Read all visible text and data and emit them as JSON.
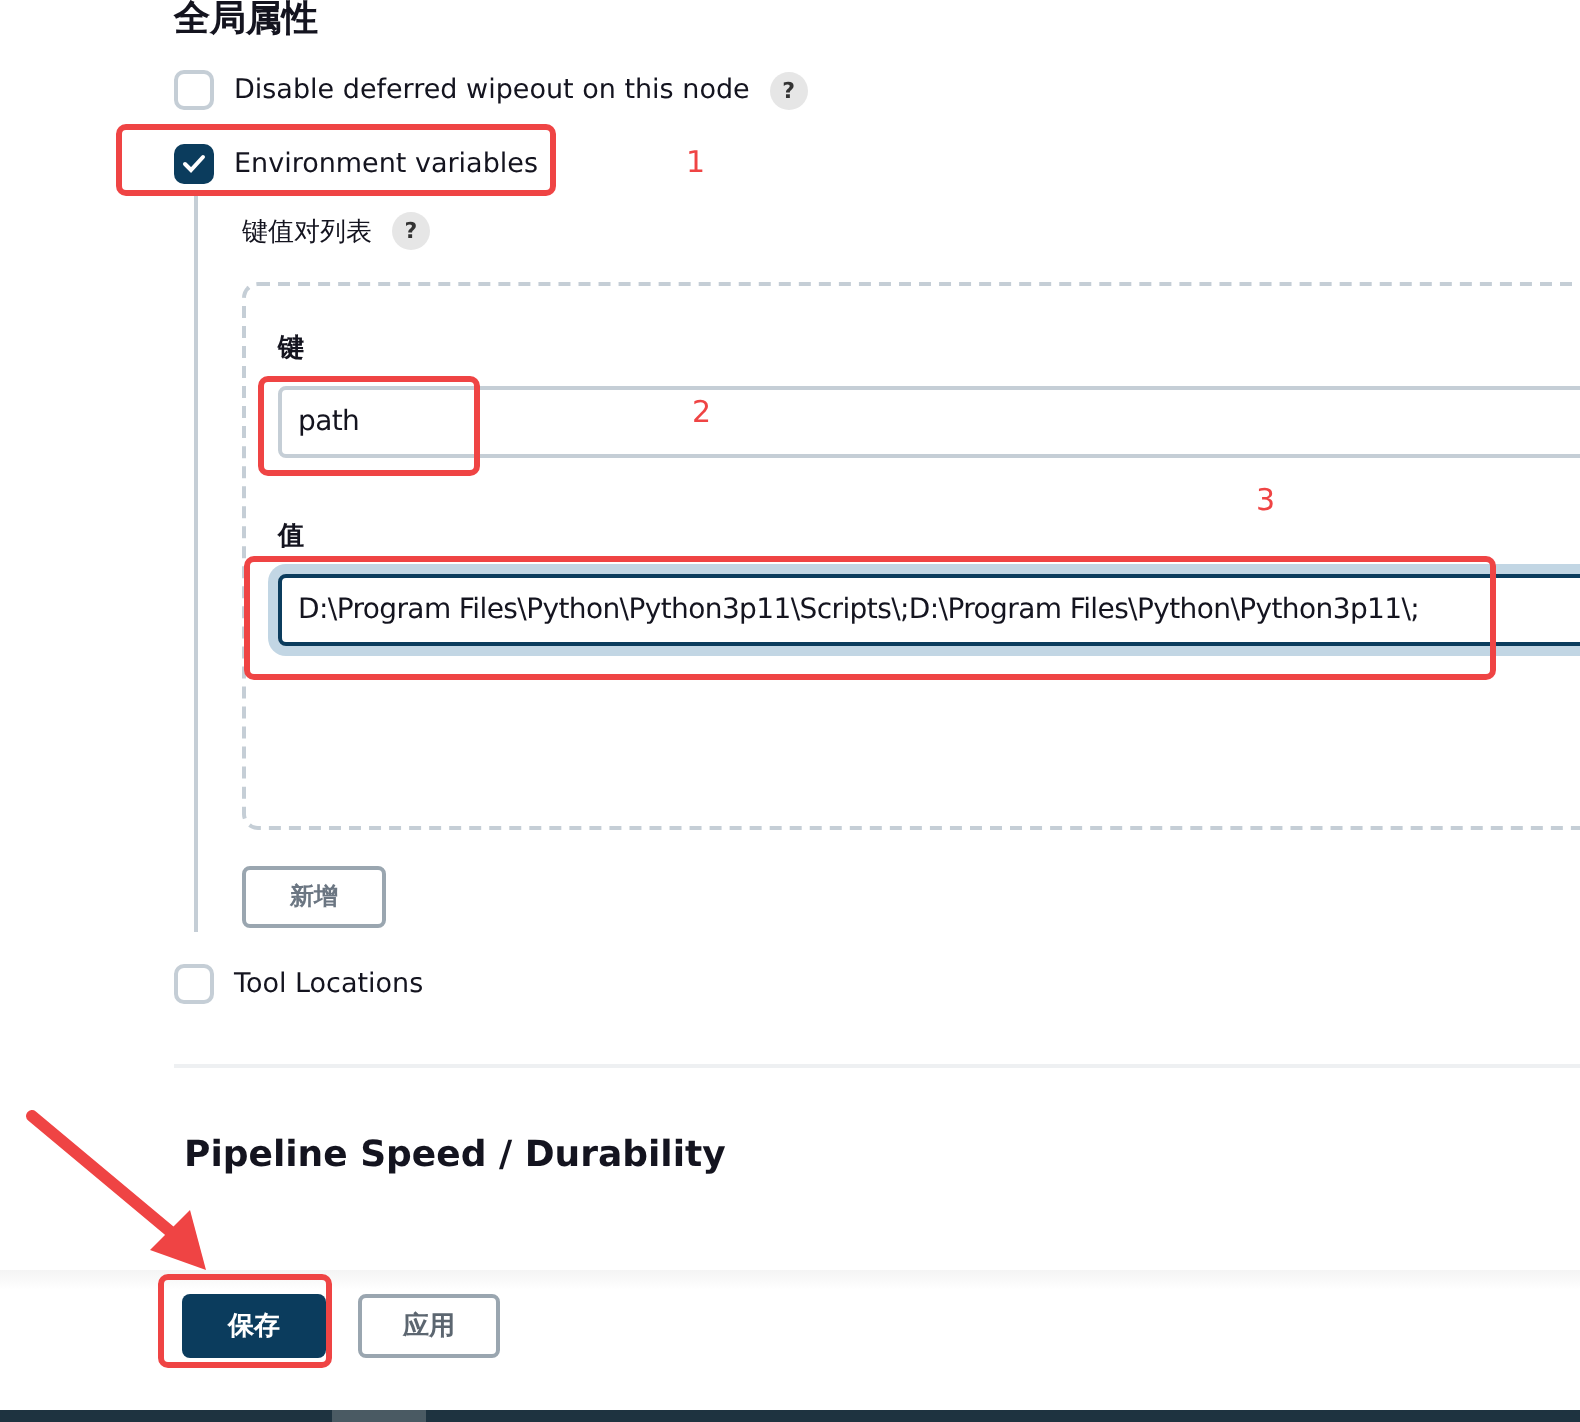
{
  "section_title": "全局属性",
  "options": [
    {
      "label": "Disable deferred wipeout on this node",
      "checked": false,
      "help": "?",
      "highlighted": false
    },
    {
      "label": "Environment variables",
      "checked": true,
      "highlighted": true,
      "marker": "1",
      "env": {
        "label": "键值对列表",
        "help": "?",
        "pairs": [
          {
            "key_label": "键",
            "key": "path",
            "key_highlighted": true,
            "key_marker": "2",
            "value_label": "值",
            "value": "D:\\Program Files\\Python\\Python3p11\\Scripts\\;D:\\Program Files\\Python\\Python3p11\\;",
            "value_highlighted": true,
            "value_marker": "3",
            "value_focused": true
          }
        ],
        "add_button": "新增"
      }
    },
    {
      "label": "Tool Locations",
      "checked": false,
      "highlighted": false
    }
  ],
  "next_section_title": "Pipeline Speed / Durability",
  "bottom_bar": {
    "buttons": [
      {
        "label": "保存",
        "kind": "primary",
        "highlighted": true,
        "arrow": true
      },
      {
        "label": "应用",
        "kind": "secondary",
        "highlighted": false,
        "arrow": false
      }
    ]
  }
}
